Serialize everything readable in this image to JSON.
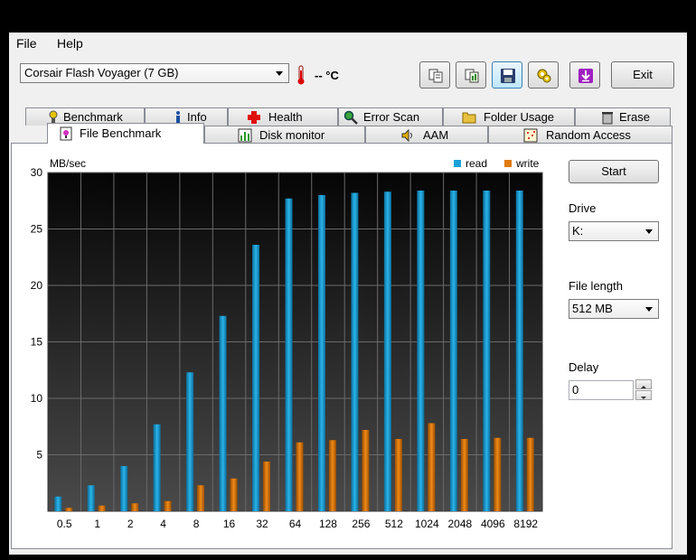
{
  "menu": {
    "file": "File",
    "help": "Help"
  },
  "toolbar": {
    "drive": "Corsair Flash Voyager (7 GB)",
    "temperature": "-- °C",
    "exit_label": "Exit"
  },
  "tabs_top": [
    "Benchmark",
    "Info",
    "Health",
    "Error Scan",
    "Folder Usage",
    "Erase"
  ],
  "tabs_bottom": [
    "File Benchmark",
    "Disk monitor",
    "AAM",
    "Random Access"
  ],
  "controls": {
    "start_label": "Start",
    "drive_label": "Drive",
    "drive_value": "K:",
    "file_length_label": "File length",
    "file_length_value": "512 MB",
    "delay_label": "Delay",
    "delay_value": "0"
  },
  "colors": {
    "read": "#1ba1d8",
    "write": "#e07b0e"
  },
  "chart_data": {
    "type": "bar",
    "ylabel": "MB/sec",
    "ylim": [
      0,
      30
    ],
    "yticks": [
      5,
      10,
      15,
      20,
      25,
      30
    ],
    "legend": "top-right",
    "categories": [
      "0.5",
      "1",
      "2",
      "4",
      "8",
      "16",
      "32",
      "64",
      "128",
      "256",
      "512",
      "1024",
      "2048",
      "4096",
      "8192"
    ],
    "series": [
      {
        "name": "read",
        "values": [
          1.3,
          2.3,
          4.0,
          7.7,
          12.3,
          17.3,
          23.6,
          27.7,
          28.0,
          28.2,
          28.3,
          28.4,
          28.4,
          28.4,
          28.4
        ]
      },
      {
        "name": "write",
        "values": [
          0.3,
          0.5,
          0.7,
          0.9,
          2.3,
          2.9,
          4.4,
          6.1,
          6.3,
          7.2,
          6.4,
          7.8,
          6.4,
          6.5,
          6.5
        ]
      }
    ]
  }
}
